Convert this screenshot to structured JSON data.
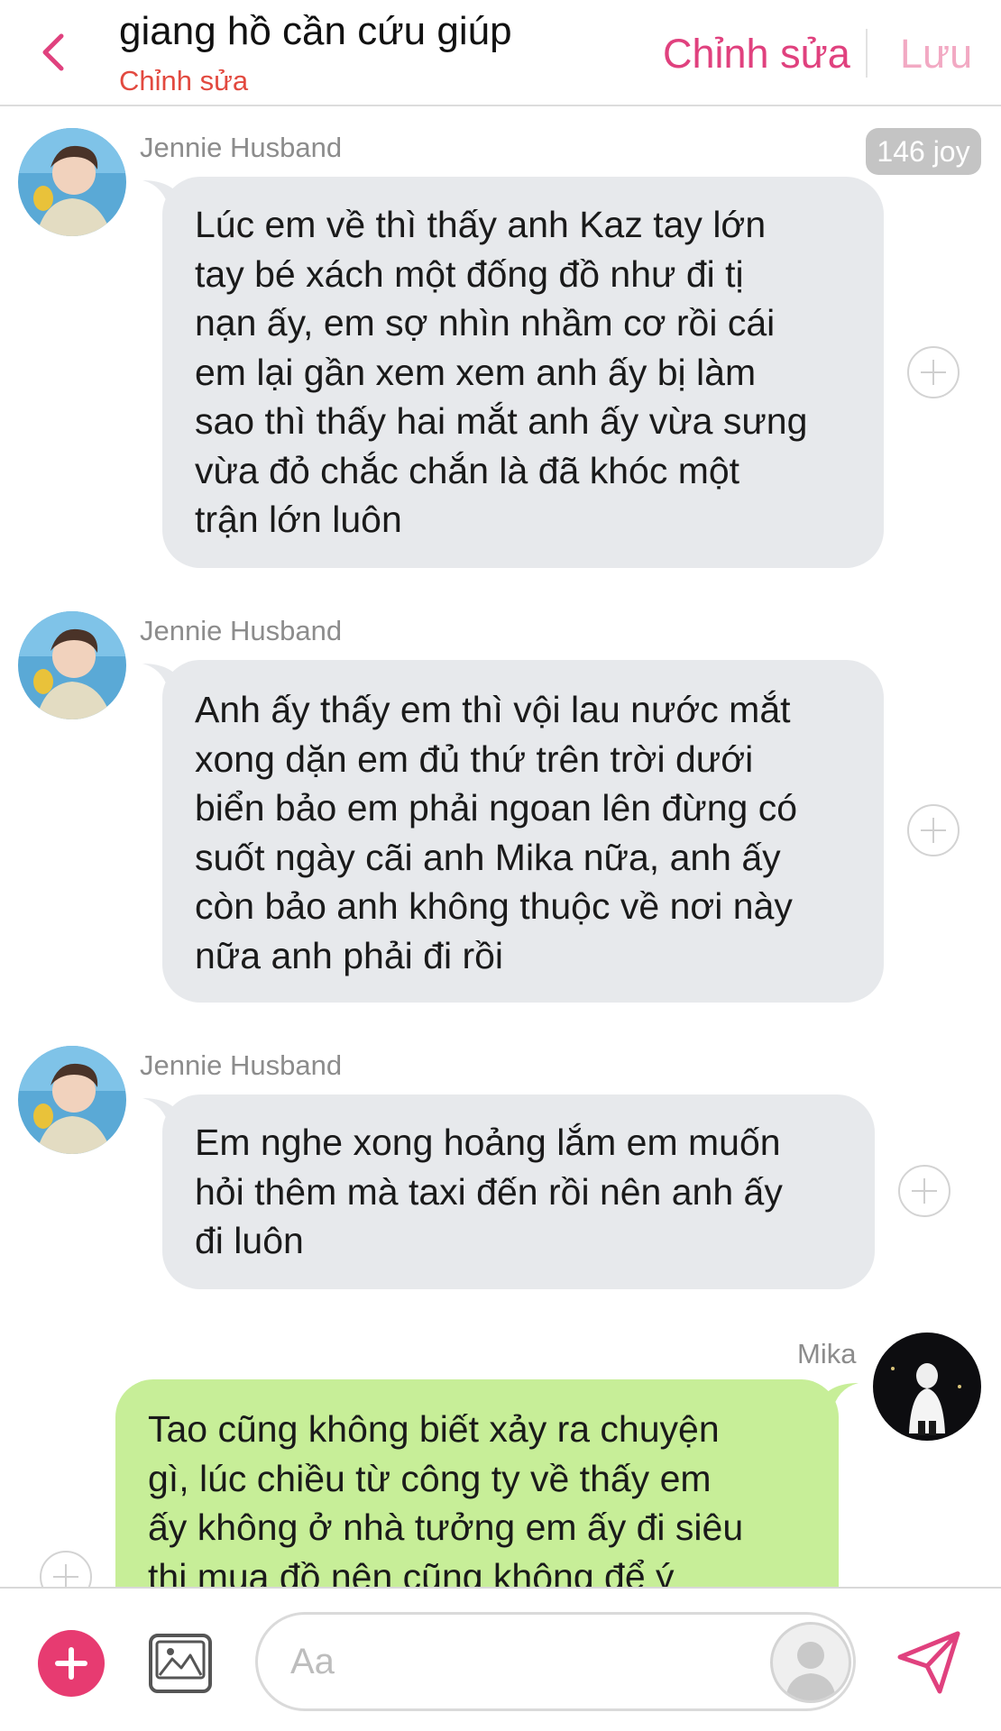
{
  "header": {
    "title": "giang hồ cần cứu giúp",
    "subtitle": "Chỉnh sửa",
    "edit_label": "Chỉnh sửa",
    "save_label": "Lưu",
    "back_icon": "chevron-left-icon",
    "accent_color": "#e0417e"
  },
  "joy_badge": "146 joy",
  "messages": [
    {
      "sender": "Jennie Husband",
      "direction": "incoming",
      "lines": [
        "Lúc em về thì thấy anh Kaz tay lớn",
        "tay bé xách một đống đồ như đi tị",
        "nạn ấy, em sợ nhìn nhầm cơ rồi cái",
        "em lại gần xem xem anh ấy bị làm",
        "sao thì thấy hai mắt anh ấy vừa sưng",
        "vừa đỏ chắc chắn là đã khóc một",
        "trận lớn luôn"
      ]
    },
    {
      "sender": "Jennie Husband",
      "direction": "incoming",
      "lines": [
        "Anh ấy thấy em thì vội lau nước mắt",
        "xong dặn em đủ thứ trên trời dưới",
        "biển bảo em phải ngoan lên đừng có",
        "suốt ngày cãi anh Mika nữa, anh ấy",
        "còn bảo anh không thuộc về nơi này",
        "nữa anh phải đi rồi"
      ]
    },
    {
      "sender": "Jennie Husband",
      "direction": "incoming",
      "lines": [
        "Em nghe xong hoảng lắm em muốn",
        "hỏi thêm mà taxi đến rồi nên anh ấy",
        "đi luôn"
      ]
    },
    {
      "sender": "Mika",
      "direction": "outgoing",
      "lines": [
        "Tao cũng không biết xảy ra chuyện",
        "gì, lúc chiều từ công ty về thấy em",
        "ấy không ở nhà tưởng em ấy đi siêu",
        "thị mua đồ nên cũng không để ý"
      ]
    }
  ],
  "composer": {
    "placeholder": "Aa",
    "plus_icon": "plus-icon",
    "image_icon": "image-icon",
    "send_icon": "send-icon",
    "plus_color": "#e73b71"
  },
  "colors": {
    "incoming_bubble": "#e7e9ec",
    "outgoing_bubble": "#c7ee98",
    "subtitle": "#e2493f"
  }
}
